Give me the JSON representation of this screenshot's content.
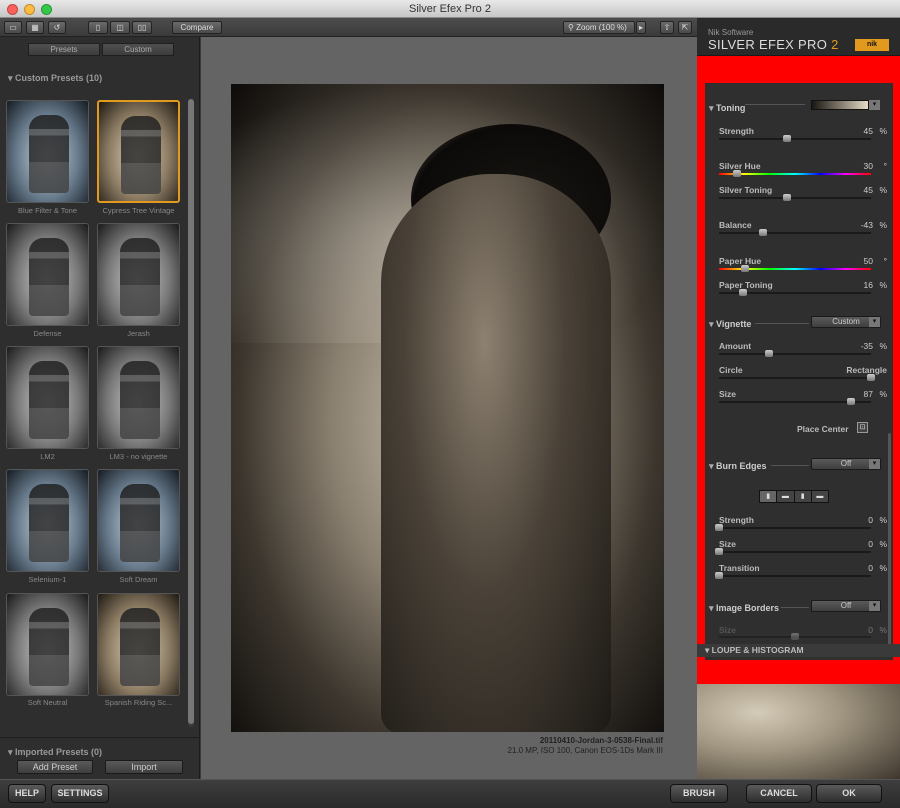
{
  "window": {
    "title": "Silver Efex Pro 2"
  },
  "toolbar": {
    "compare": "Compare",
    "zoom": "Zoom (100 %)"
  },
  "left": {
    "tabs": {
      "presets": "Presets",
      "custom": "Custom"
    },
    "custom_header": "Custom Presets (10)",
    "imported_header": "Imported Presets (0)",
    "presets": [
      {
        "label": "Blue Filter & Tone"
      },
      {
        "label": "Cypress Tree Vintage"
      },
      {
        "label": "Defense"
      },
      {
        "label": "Jerash"
      },
      {
        "label": "LM2"
      },
      {
        "label": "LM3 - no vignette"
      },
      {
        "label": "Selenium-1"
      },
      {
        "label": "Soft Dream"
      },
      {
        "label": "Soft Neutral"
      },
      {
        "label": "Spanish Riding Sc..."
      }
    ],
    "add_preset": "Add Preset",
    "import": "Import"
  },
  "image": {
    "filename": "20110410-Jordan-3-0538-Final.tif",
    "meta": "21.0 MP, ISO 100, Canon EOS-1Ds Mark III"
  },
  "brand": {
    "company": "Nik Software",
    "product": "SILVER EFEX PRO",
    "version": "2",
    "logo": "nik"
  },
  "panel": {
    "toning": {
      "title": "Toning",
      "strength": {
        "label": "Strength",
        "value": "45",
        "unit": "%",
        "pos": 0.45
      },
      "silver_hue": {
        "label": "Silver Hue",
        "value": "30",
        "unit": "°",
        "pos": 0.12
      },
      "silver_toning": {
        "label": "Silver Toning",
        "value": "45",
        "unit": "%",
        "pos": 0.45
      },
      "balance": {
        "label": "Balance",
        "value": "-43",
        "unit": "%",
        "pos": 0.29
      },
      "paper_hue": {
        "label": "Paper Hue",
        "value": "50",
        "unit": "°",
        "pos": 0.17
      },
      "paper_toning": {
        "label": "Paper Toning",
        "value": "16",
        "unit": "%",
        "pos": 0.16
      }
    },
    "vignette": {
      "title": "Vignette",
      "preset": "Custom",
      "amount": {
        "label": "Amount",
        "value": "-35",
        "unit": "%",
        "pos": 0.33
      },
      "circle": "Circle",
      "rectangle": "Rectangle",
      "size": {
        "label": "Size",
        "value": "87",
        "unit": "%",
        "pos": 0.87
      },
      "place_center": "Place Center"
    },
    "burn_edges": {
      "title": "Burn Edges",
      "preset": "Off",
      "strength": {
        "label": "Strength",
        "value": "0",
        "unit": "%",
        "pos": 0
      },
      "size": {
        "label": "Size",
        "value": "0",
        "unit": "%",
        "pos": 0
      },
      "transition": {
        "label": "Transition",
        "value": "0",
        "unit": "%",
        "pos": 0
      }
    },
    "image_borders": {
      "title": "Image Borders",
      "preset": "Off",
      "size": {
        "label": "Size",
        "value": "0",
        "unit": "%"
      }
    },
    "loupe": "LOUPE & HISTOGRAM"
  },
  "bottom": {
    "help": "HELP",
    "settings": "SETTINGS",
    "brush": "BRUSH",
    "cancel": "CANCEL",
    "ok": "OK"
  },
  "colors": {
    "highlight": "#ff0000",
    "selection": "#e19a1e"
  }
}
